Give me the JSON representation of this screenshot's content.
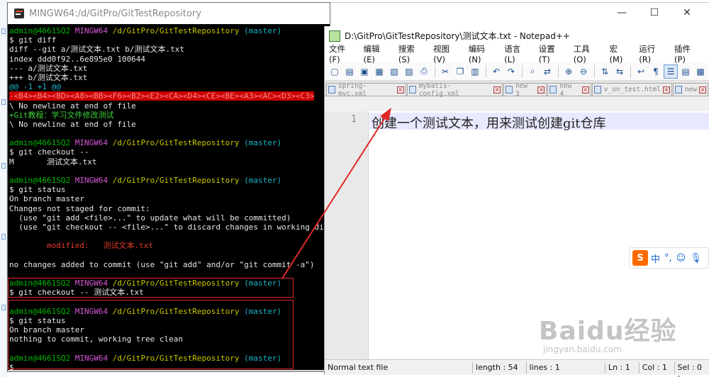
{
  "terminal": {
    "title": "MINGW64:/d/GitPro/GitTestRepository",
    "lines": [
      [
        {
          "t": "admin@4661SQ2 ",
          "c": "c-green"
        },
        {
          "t": "MINGW64 ",
          "c": "c-purple"
        },
        {
          "t": "/d/GitPro/GitTestRepository ",
          "c": "c-yellow"
        },
        {
          "t": "(master)",
          "c": "c-cyan"
        }
      ],
      [
        {
          "t": "$ git diff",
          "c": "c-white"
        }
      ],
      [
        {
          "t": "diff --git a/测试文本.txt b/测试文本.txt",
          "c": "c-white"
        }
      ],
      [
        {
          "t": "index ddd0f92..6e895e0 100644",
          "c": "c-white"
        }
      ],
      [
        {
          "t": "--- a/测试文本.txt",
          "c": "c-white"
        }
      ],
      [
        {
          "t": "+++ b/测试文本.txt",
          "c": "c-white"
        }
      ],
      [
        {
          "t": "@@ -1 +1 @@",
          "c": "c-cyan"
        }
      ],
      [
        {
          "t": "-<B4><B4><BD><A8><BB><F6><B2><E2><CA><D4><CE><BE><A3><AC><D3><C3>",
          "c": "hl-red"
        }
      ],
      [
        {
          "t": "\\ No newline at end of file",
          "c": "c-white"
        }
      ],
      [
        {
          "t": "+Git教程：学习文件修改测试",
          "c": "c-addgreen"
        }
      ],
      [
        {
          "t": "\\ No newline at end of file",
          "c": "c-white"
        }
      ],
      [
        {
          "t": "",
          "c": "c-white"
        }
      ],
      [
        {
          "t": "admin@4661SQ2 ",
          "c": "c-green"
        },
        {
          "t": "MINGW64 ",
          "c": "c-purple"
        },
        {
          "t": "/d/GitPro/GitTestRepository ",
          "c": "c-yellow"
        },
        {
          "t": "(master)",
          "c": "c-cyan"
        }
      ],
      [
        {
          "t": "$ git checkout --",
          "c": "c-white"
        }
      ],
      [
        {
          "t": "M       测试文本.txt",
          "c": "c-white"
        }
      ],
      [
        {
          "t": "",
          "c": "c-white"
        }
      ],
      [
        {
          "t": "admin@4661SQ2 ",
          "c": "c-green"
        },
        {
          "t": "MINGW64 ",
          "c": "c-purple"
        },
        {
          "t": "/d/GitPro/GitTestRepository ",
          "c": "c-yellow"
        },
        {
          "t": "(master)",
          "c": "c-cyan"
        }
      ],
      [
        {
          "t": "$ git status",
          "c": "c-white"
        }
      ],
      [
        {
          "t": "On branch master",
          "c": "c-white"
        }
      ],
      [
        {
          "t": "Changes not staged for commit:",
          "c": "c-white"
        }
      ],
      [
        {
          "t": "  (use \"git add <file>...\" to update what will be committed)",
          "c": "c-white"
        }
      ],
      [
        {
          "t": "  (use \"git checkout -- <file>...\" to discard changes in working di",
          "c": "c-white"
        }
      ],
      [
        {
          "t": "",
          "c": "c-white"
        }
      ],
      [
        {
          "t": "        modified:   测试文本.txt",
          "c": "c-red"
        }
      ],
      [
        {
          "t": "",
          "c": "c-white"
        }
      ],
      [
        {
          "t": "no changes added to commit (use \"git add\" and/or \"git commit -a\")",
          "c": "c-white"
        }
      ],
      [
        {
          "t": "",
          "c": "c-white"
        }
      ],
      [
        {
          "t": "admin@4661SQ2 ",
          "c": "c-green"
        },
        {
          "t": "MINGW64 ",
          "c": "c-purple"
        },
        {
          "t": "/d/GitPro/GitTestRepository ",
          "c": "c-yellow"
        },
        {
          "t": "(master)",
          "c": "c-cyan"
        }
      ],
      [
        {
          "t": "$ git checkout -- 测试文本.txt",
          "c": "c-white"
        }
      ],
      [
        {
          "t": "",
          "c": "c-white"
        }
      ],
      [
        {
          "t": "admin@4661SQ2 ",
          "c": "c-green"
        },
        {
          "t": "MINGW64 ",
          "c": "c-purple"
        },
        {
          "t": "/d/GitPro/GitTestRepository ",
          "c": "c-yellow"
        },
        {
          "t": "(master)",
          "c": "c-cyan"
        }
      ],
      [
        {
          "t": "$ git status",
          "c": "c-white"
        }
      ],
      [
        {
          "t": "On branch master",
          "c": "c-white"
        }
      ],
      [
        {
          "t": "nothing to commit, working tree clean",
          "c": "c-white"
        }
      ],
      [
        {
          "t": "",
          "c": "c-white"
        }
      ],
      [
        {
          "t": "admin@4661SQ2 ",
          "c": "c-green"
        },
        {
          "t": "MINGW64 ",
          "c": "c-purple"
        },
        {
          "t": "/d/GitPro/GitTestRepository ",
          "c": "c-yellow"
        },
        {
          "t": "(master)",
          "c": "c-cyan"
        }
      ],
      [
        {
          "t": "$ ",
          "c": "c-white"
        }
      ]
    ]
  },
  "window_controls": {
    "minimize": "—",
    "maximize": "☐",
    "close": "✕"
  },
  "notepad": {
    "title": "D:\\GitPro\\GitTestRepository\\测试文本.txt - Notepad++",
    "menu": [
      "文件(F)",
      "编辑(E)",
      "搜索(S)",
      "视图(V)",
      "编码(N)",
      "语言(L)",
      "设置(T)",
      "工具(O)",
      "宏(M)",
      "运行(R)",
      "插件(P)"
    ],
    "tabs": [
      {
        "label": "spring-mvc.xml",
        "active": false
      },
      {
        "label": "mybatis-config.xml",
        "active": false
      },
      {
        "label": "new 3",
        "active": false
      },
      {
        "label": "new 4",
        "active": false
      },
      {
        "label": "v_on_test.html",
        "active": false
      },
      {
        "label": "new",
        "active": false
      }
    ],
    "line_number": "1",
    "line_text": "创建一个测试文本，用来测试创建git仓库",
    "status": {
      "type": "Normal text file",
      "length": "length : 54",
      "lines": "lines : 1",
      "ln": "Ln : 1",
      "col": "Col : 1",
      "sel": "Sel : 0 |"
    }
  },
  "ime": {
    "logo": "S",
    "mode": "中",
    "punct": "°,",
    "emoji": "☺",
    "mic": "🎙"
  },
  "watermark": {
    "brand": "Baidu经验",
    "url": "jingyan.baidu.com"
  },
  "colors": {
    "annotation_red": "#e02727",
    "terminal_bg": "#000000",
    "prompt_green": "#00b800"
  }
}
